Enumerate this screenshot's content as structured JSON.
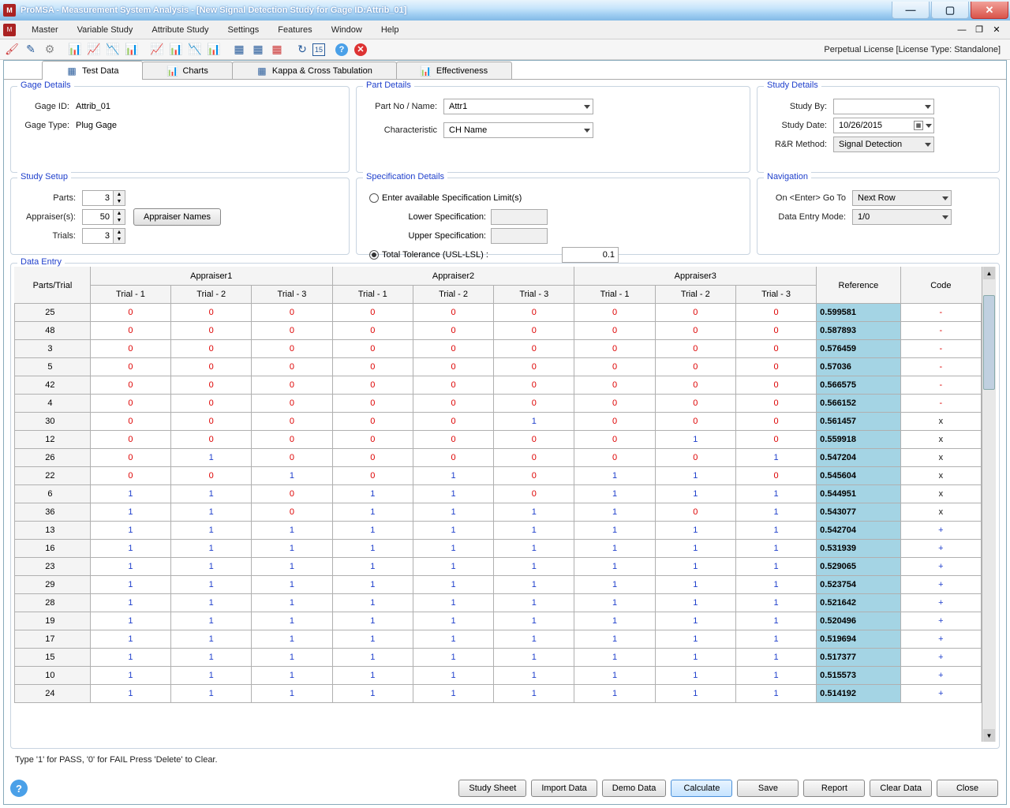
{
  "window": {
    "title": "ProMSA - Measurement System Analysis  -  [New Signal Detection Study for Gage ID:Attrib_01]"
  },
  "menubar": {
    "items": [
      "Master",
      "Variable Study",
      "Attribute Study",
      "Settings",
      "Features",
      "Window",
      "Help"
    ]
  },
  "license": "Perpetual License [License Type: Standalone]",
  "tabs": {
    "items": [
      "Test Data",
      "Charts",
      "Kappa & Cross Tabulation",
      "Effectiveness"
    ],
    "active_index": 0
  },
  "gage": {
    "title": "Gage Details",
    "id_label": "Gage ID:",
    "id_value": "Attrib_01",
    "type_label": "Gage Type:",
    "type_value": "Plug Gage"
  },
  "part": {
    "title": "Part Details",
    "partno_label": "Part No / Name:",
    "partno_value": "Attr1",
    "char_label": "Characteristic",
    "char_value": "CH Name"
  },
  "study": {
    "title": "Study Details",
    "by_label": "Study By:",
    "by_value": "",
    "date_label": "Study Date:",
    "date_value": "10/26/2015",
    "method_label": "R&R Method:",
    "method_value": "Signal Detection"
  },
  "setup": {
    "title": "Study Setup",
    "parts_label": "Parts:",
    "parts_value": "3",
    "appraisers_label": "Appraiser(s):",
    "appraisers_value": "50",
    "trials_label": "Trials:",
    "trials_value": "3",
    "appraiser_names_btn": "Appraiser Names"
  },
  "spec": {
    "title": "Specification Details",
    "radio1_label": "Enter available Specification Limit(s)",
    "lower_label": "Lower Specification:",
    "upper_label": "Upper Specification:",
    "radio2_label": "Total Tolerance (USL-LSL) :",
    "tol_value": "0.1",
    "selected": "tolerance"
  },
  "nav": {
    "title": "Navigation",
    "goto_label": "On <Enter> Go To",
    "goto_value": "Next Row",
    "mode_label": "Data Entry Mode:",
    "mode_value": "1/0"
  },
  "dataentry": {
    "title": "Data Entry",
    "appraisers": [
      "Appraiser1",
      "Appraiser2",
      "Appraiser3"
    ],
    "trials": [
      "Trial - 1",
      "Trial - 2",
      "Trial - 3"
    ],
    "col_parts": "Parts/Trial",
    "col_ref": "Reference",
    "col_code": "Code",
    "rows": [
      {
        "p": "25",
        "v": [
          0,
          0,
          0,
          0,
          0,
          0,
          0,
          0,
          0
        ],
        "ref": "0.599581",
        "code": "-"
      },
      {
        "p": "48",
        "v": [
          0,
          0,
          0,
          0,
          0,
          0,
          0,
          0,
          0
        ],
        "ref": "0.587893",
        "code": "-"
      },
      {
        "p": "3",
        "v": [
          0,
          0,
          0,
          0,
          0,
          0,
          0,
          0,
          0
        ],
        "ref": "0.576459",
        "code": "-"
      },
      {
        "p": "5",
        "v": [
          0,
          0,
          0,
          0,
          0,
          0,
          0,
          0,
          0
        ],
        "ref": "0.57036",
        "code": "-"
      },
      {
        "p": "42",
        "v": [
          0,
          0,
          0,
          0,
          0,
          0,
          0,
          0,
          0
        ],
        "ref": "0.566575",
        "code": "-"
      },
      {
        "p": "4",
        "v": [
          0,
          0,
          0,
          0,
          0,
          0,
          0,
          0,
          0
        ],
        "ref": "0.566152",
        "code": "-"
      },
      {
        "p": "30",
        "v": [
          0,
          0,
          0,
          0,
          0,
          1,
          0,
          0,
          0
        ],
        "ref": "0.561457",
        "code": "x"
      },
      {
        "p": "12",
        "v": [
          0,
          0,
          0,
          0,
          0,
          0,
          0,
          1,
          0
        ],
        "ref": "0.559918",
        "code": "x"
      },
      {
        "p": "26",
        "v": [
          0,
          1,
          0,
          0,
          0,
          0,
          0,
          0,
          1
        ],
        "ref": "0.547204",
        "code": "x"
      },
      {
        "p": "22",
        "v": [
          0,
          0,
          1,
          0,
          1,
          0,
          1,
          1,
          0
        ],
        "ref": "0.545604",
        "code": "x"
      },
      {
        "p": "6",
        "v": [
          1,
          1,
          0,
          1,
          1,
          0,
          1,
          1,
          1
        ],
        "ref": "0.544951",
        "code": "x"
      },
      {
        "p": "36",
        "v": [
          1,
          1,
          0,
          1,
          1,
          1,
          1,
          0,
          1
        ],
        "ref": "0.543077",
        "code": "x"
      },
      {
        "p": "13",
        "v": [
          1,
          1,
          1,
          1,
          1,
          1,
          1,
          1,
          1
        ],
        "ref": "0.542704",
        "code": "+"
      },
      {
        "p": "16",
        "v": [
          1,
          1,
          1,
          1,
          1,
          1,
          1,
          1,
          1
        ],
        "ref": "0.531939",
        "code": "+"
      },
      {
        "p": "23",
        "v": [
          1,
          1,
          1,
          1,
          1,
          1,
          1,
          1,
          1
        ],
        "ref": "0.529065",
        "code": "+"
      },
      {
        "p": "29",
        "v": [
          1,
          1,
          1,
          1,
          1,
          1,
          1,
          1,
          1
        ],
        "ref": "0.523754",
        "code": "+"
      },
      {
        "p": "28",
        "v": [
          1,
          1,
          1,
          1,
          1,
          1,
          1,
          1,
          1
        ],
        "ref": "0.521642",
        "code": "+"
      },
      {
        "p": "19",
        "v": [
          1,
          1,
          1,
          1,
          1,
          1,
          1,
          1,
          1
        ],
        "ref": "0.520496",
        "code": "+"
      },
      {
        "p": "17",
        "v": [
          1,
          1,
          1,
          1,
          1,
          1,
          1,
          1,
          1
        ],
        "ref": "0.519694",
        "code": "+"
      },
      {
        "p": "15",
        "v": [
          1,
          1,
          1,
          1,
          1,
          1,
          1,
          1,
          1
        ],
        "ref": "0.517377",
        "code": "+"
      },
      {
        "p": "10",
        "v": [
          1,
          1,
          1,
          1,
          1,
          1,
          1,
          1,
          1
        ],
        "ref": "0.515573",
        "code": "+"
      },
      {
        "p": "24",
        "v": [
          1,
          1,
          1,
          1,
          1,
          1,
          1,
          1,
          1
        ],
        "ref": "0.514192",
        "code": "+"
      }
    ],
    "hint": "Type '1' for PASS, '0' for FAIL Press 'Delete' to Clear."
  },
  "buttons": {
    "study_sheet": "Study Sheet",
    "import": "Import Data",
    "demo": "Demo Data",
    "calculate": "Calculate",
    "save": "Save",
    "report": "Report",
    "clear": "Clear Data",
    "close": "Close"
  }
}
